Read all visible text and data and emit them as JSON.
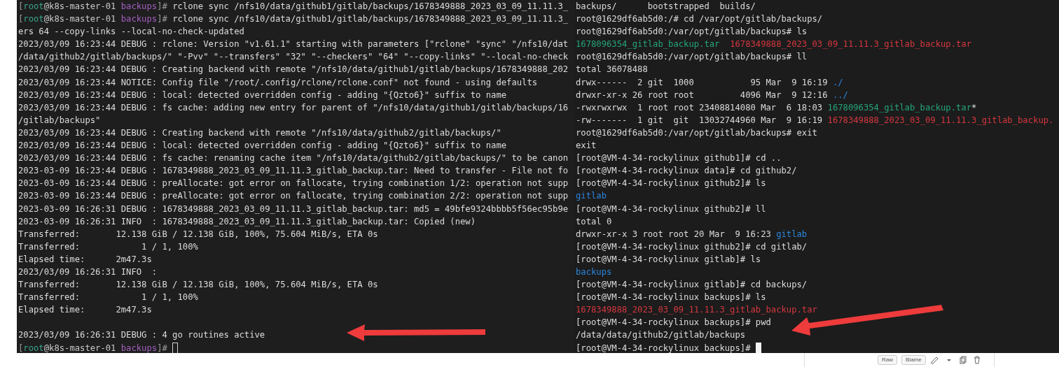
{
  "terminals": [
    {
      "lines": [
        {
          "kind": "prompt",
          "segments": [
            {
              "kind": "bracket",
              "text": "["
            },
            {
              "kind": "user",
              "text": "root"
            },
            {
              "kind": "host",
              "text": "@k8s-master-01 "
            },
            {
              "kind": "cwd",
              "text": "backups"
            },
            {
              "kind": "bracket",
              "text": "]# "
            },
            {
              "kind": "plain",
              "text": "rclone sync /nfs10/data/github1/gitlab/backups/1678349888_2023_03_09_11.11.3_"
            }
          ]
        },
        {
          "kind": "prompt",
          "segments": [
            {
              "kind": "bracket",
              "text": "["
            },
            {
              "kind": "user",
              "text": "root"
            },
            {
              "kind": "host",
              "text": "@k8s-master-01 "
            },
            {
              "kind": "cwd",
              "text": "backups"
            },
            {
              "kind": "bracket",
              "text": "]# "
            },
            {
              "kind": "plain",
              "text": "rclone sync /nfs10/data/github1/gitlab/backups/1678349888_2023_03_09_11.11.3_"
            }
          ]
        },
        {
          "kind": "text",
          "text": "ers 64 --copy-links --local-no-check-updated"
        },
        {
          "kind": "text",
          "text": "2023/03/09 16:23:44 DEBUG : rclone: Version \"v1.61.1\" starting with parameters [\"rclone\" \"sync\" \"/nfs10/dat"
        },
        {
          "kind": "text",
          "text": "/data/github2/gitlab/backups/\" \"-Pvv\" \"--transfers\" \"32\" \"--checkers\" \"64\" \"--copy-links\" \"--local-no-check"
        },
        {
          "kind": "text",
          "text": "2023/03/09 16:23:44 DEBUG : Creating backend with remote \"/nfs10/data/github1/gitlab/backups/1678349888_202"
        },
        {
          "kind": "text",
          "text": "2023/03/09 16:23:44 NOTICE: Config file \"/root/.config/rclone/rclone.conf\" not found - using defaults"
        },
        {
          "kind": "text",
          "text": "2023/03/09 16:23:44 DEBUG : local: detected overridden config - adding \"{Qzto6}\" suffix to name"
        },
        {
          "kind": "text",
          "text": "2023/03/09 16:23:44 DEBUG : fs cache: adding new entry for parent of \"/nfs10/data/github1/gitlab/backups/16"
        },
        {
          "kind": "text",
          "text": "/gitlab/backups\""
        },
        {
          "kind": "text",
          "text": "2023/03/09 16:23:44 DEBUG : Creating backend with remote \"/nfs10/data/github2/gitlab/backups/\""
        },
        {
          "kind": "text",
          "text": "2023/03/09 16:23:44 DEBUG : local: detected overridden config - adding \"{Qzto6}\" suffix to name"
        },
        {
          "kind": "text",
          "text": "2023/03/09 16:23:44 DEBUG : fs cache: renaming cache item \"/nfs10/data/github2/gitlab/backups/\" to be canon"
        },
        {
          "kind": "text",
          "text": "2023-03-09 16:23:44 DEBUG : 1678349888_2023_03_09_11.11.3_gitlab_backup.tar: Need to transfer - File not fo"
        },
        {
          "kind": "text",
          "text": "2023-03-09 16:23:44 DEBUG : preAllocate: got error on fallocate, trying combination 1/2: operation not supp"
        },
        {
          "kind": "text",
          "text": "2023-03-09 16:23:44 DEBUG : preAllocate: got error on fallocate, trying combination 2/2: operation not supp"
        },
        {
          "kind": "text",
          "text": "2023-03-09 16:26:31 DEBUG : 1678349888_2023_03_09_11.11.3_gitlab_backup.tar: md5 = 49bfe9324bbbb5f56ec95b9e"
        },
        {
          "kind": "text",
          "text": "2023-03-09 16:26:31 INFO  : 1678349888_2023_03_09_11.11.3_gitlab_backup.tar: Copied (new)"
        },
        {
          "kind": "text",
          "text": "Transferred:       12.138 GiB / 12.138 GiB, 100%, 75.604 MiB/s, ETA 0s"
        },
        {
          "kind": "text",
          "text": "Transferred:            1 / 1, 100%"
        },
        {
          "kind": "text",
          "text": "Elapsed time:      2m47.3s"
        },
        {
          "kind": "text",
          "text": "2023/03/09 16:26:31 INFO  :"
        },
        {
          "kind": "text",
          "text": "Transferred:       12.138 GiB / 12.138 GiB, 100%, 75.604 MiB/s, ETA 0s"
        },
        {
          "kind": "text",
          "text": "Transferred:            1 / 1, 100%"
        },
        {
          "kind": "text",
          "text": "Elapsed time:      2m47.3s"
        },
        {
          "kind": "blank"
        },
        {
          "kind": "text",
          "text": "2023/03/09 16:26:31 DEBUG : 4 go routines active"
        },
        {
          "kind": "prompt",
          "segments": [
            {
              "kind": "bracket",
              "text": "["
            },
            {
              "kind": "user",
              "text": "root"
            },
            {
              "kind": "host",
              "text": "@k8s-master-01 "
            },
            {
              "kind": "cwd",
              "text": "backups"
            },
            {
              "kind": "bracket",
              "text": "]# "
            }
          ],
          "cursor": {
            "focused": false
          }
        }
      ]
    },
    {
      "lines": [
        {
          "kind": "text",
          "text": "backups/      bootstrapped  builds/"
        },
        {
          "kind": "text",
          "text": "root@1629df6ab5d0:/# cd /var/opt/gitlab/backups/"
        },
        {
          "kind": "text",
          "text": "root@1629df6ab5d0:/var/opt/gitlab/backups# ls"
        },
        {
          "kind": "prompt",
          "segments": [
            {
              "kind": "executable",
              "text": "1678096354_gitlab_backup.tar"
            },
            {
              "kind": "archive",
              "text": "  1678349888_2023_03_09_11.11.3_gitlab_backup.tar"
            }
          ]
        },
        {
          "kind": "text",
          "text": "root@1629df6ab5d0:/var/opt/gitlab/backups# ll"
        },
        {
          "kind": "text",
          "text": "total 36078488"
        },
        {
          "kind": "prompt",
          "segments": [
            {
              "kind": "plain",
              "text": "drwx------  2 git  1000           95 Mar  9 16:19 "
            },
            {
              "kind": "directory",
              "text": "./"
            }
          ]
        },
        {
          "kind": "prompt",
          "segments": [
            {
              "kind": "plain",
              "text": "drwxr-xr-x 26 root root         4096 Mar  9 12:16 "
            },
            {
              "kind": "directory",
              "text": "../"
            }
          ]
        },
        {
          "kind": "prompt",
          "segments": [
            {
              "kind": "plain",
              "text": "-rwxrwxrwx  1 root root 23408814080 Mar  6 18:03 "
            },
            {
              "kind": "executable",
              "text": "1678096354_gitlab_backup.tar"
            },
            {
              "kind": "plain",
              "text": "*"
            }
          ]
        },
        {
          "kind": "prompt",
          "segments": [
            {
              "kind": "plain",
              "text": "-rw-------  1 git  git  13032744960 Mar  9 16:19 "
            },
            {
              "kind": "archive",
              "text": "1678349888_2023_03_09_11.11.3_gitlab_backup."
            }
          ]
        },
        {
          "kind": "text",
          "text": "root@1629df6ab5d0:/var/opt/gitlab/backups# exit"
        },
        {
          "kind": "text",
          "text": "exit"
        },
        {
          "kind": "text",
          "text": "[root@VM-4-34-rockylinux github1]# cd .."
        },
        {
          "kind": "text",
          "text": "[root@VM-4-34-rockylinux data]# cd github2/"
        },
        {
          "kind": "text",
          "text": "[root@VM-4-34-rockylinux github2]# ls"
        },
        {
          "kind": "prompt",
          "segments": [
            {
              "kind": "directory",
              "text": "gitlab"
            }
          ]
        },
        {
          "kind": "text",
          "text": "[root@VM-4-34-rockylinux github2]# ll"
        },
        {
          "kind": "text",
          "text": "total 0"
        },
        {
          "kind": "prompt",
          "segments": [
            {
              "kind": "plain",
              "text": "drwxr-xr-x 3 root root 20 Mar  9 16:23 "
            },
            {
              "kind": "directory",
              "text": "gitlab"
            }
          ]
        },
        {
          "kind": "text",
          "text": "[root@VM-4-34-rockylinux github2]# cd gitlab/"
        },
        {
          "kind": "text",
          "text": "[root@VM-4-34-rockylinux gitlab]# ls"
        },
        {
          "kind": "prompt",
          "segments": [
            {
              "kind": "directory",
              "text": "backups"
            }
          ]
        },
        {
          "kind": "text",
          "text": "[root@VM-4-34-rockylinux gitlab]# cd backups/"
        },
        {
          "kind": "text",
          "text": "[root@VM-4-34-rockylinux backups]# ls"
        },
        {
          "kind": "prompt",
          "segments": [
            {
              "kind": "archive",
              "text": "1678349888_2023_03_09_11.11.3_gitlab_backup.tar"
            }
          ]
        },
        {
          "kind": "text",
          "text": "[root@VM-4-34-rockylinux backups]# pwd"
        },
        {
          "kind": "text",
          "text": "/data/data/github2/gitlab/backups"
        },
        {
          "kind": "prompt",
          "segments": [
            {
              "kind": "plain",
              "text": "[root@VM-4-34-rockylinux backups]# "
            }
          ],
          "cursor": {
            "focused": true
          }
        }
      ]
    }
  ],
  "toolbar": {
    "buttons": [
      {
        "label": "Raw"
      },
      {
        "label": "Blame"
      }
    ]
  }
}
